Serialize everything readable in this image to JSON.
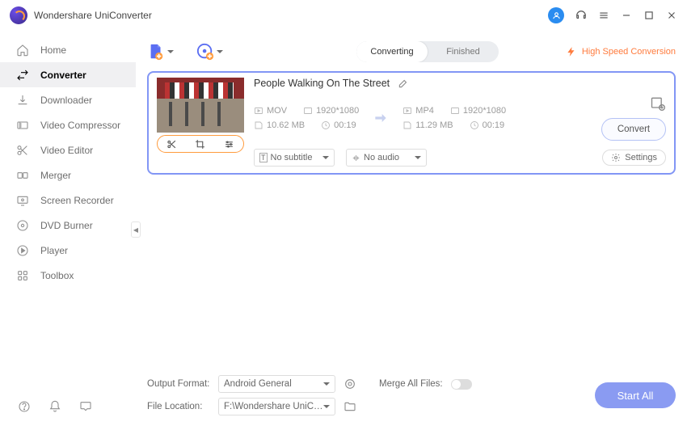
{
  "app": {
    "title": "Wondershare UniConverter"
  },
  "titlebar_icons": [
    "user",
    "headset",
    "menu",
    "minimize",
    "maximize",
    "close"
  ],
  "sidebar": {
    "items": [
      {
        "id": "home",
        "label": "Home"
      },
      {
        "id": "converter",
        "label": "Converter",
        "active": true
      },
      {
        "id": "downloader",
        "label": "Downloader"
      },
      {
        "id": "compressor",
        "label": "Video Compressor"
      },
      {
        "id": "editor",
        "label": "Video Editor"
      },
      {
        "id": "merger",
        "label": "Merger"
      },
      {
        "id": "screen",
        "label": "Screen Recorder"
      },
      {
        "id": "dvd",
        "label": "DVD Burner"
      },
      {
        "id": "player",
        "label": "Player"
      },
      {
        "id": "toolbox",
        "label": "Toolbox"
      }
    ]
  },
  "tabs": {
    "converting": "Converting",
    "finished": "Finished",
    "active": "converting"
  },
  "hsc": {
    "label": "High Speed Conversion"
  },
  "item": {
    "title": "People Walking On The Street",
    "src": {
      "format": "MOV",
      "res": "1920*1080",
      "size": "10.62 MB",
      "dur": "00:19"
    },
    "dst": {
      "format": "MP4",
      "res": "1920*1080",
      "size": "11.29 MB",
      "dur": "00:19"
    },
    "subtitle": "No subtitle",
    "audio": "No audio",
    "settings_label": "Settings",
    "convert_label": "Convert"
  },
  "bottom": {
    "format_label": "Output Format:",
    "format_value": "Android General",
    "location_label": "File Location:",
    "location_value": "F:\\Wondershare UniConverter",
    "merge_label": "Merge All Files:",
    "start_label": "Start All"
  }
}
